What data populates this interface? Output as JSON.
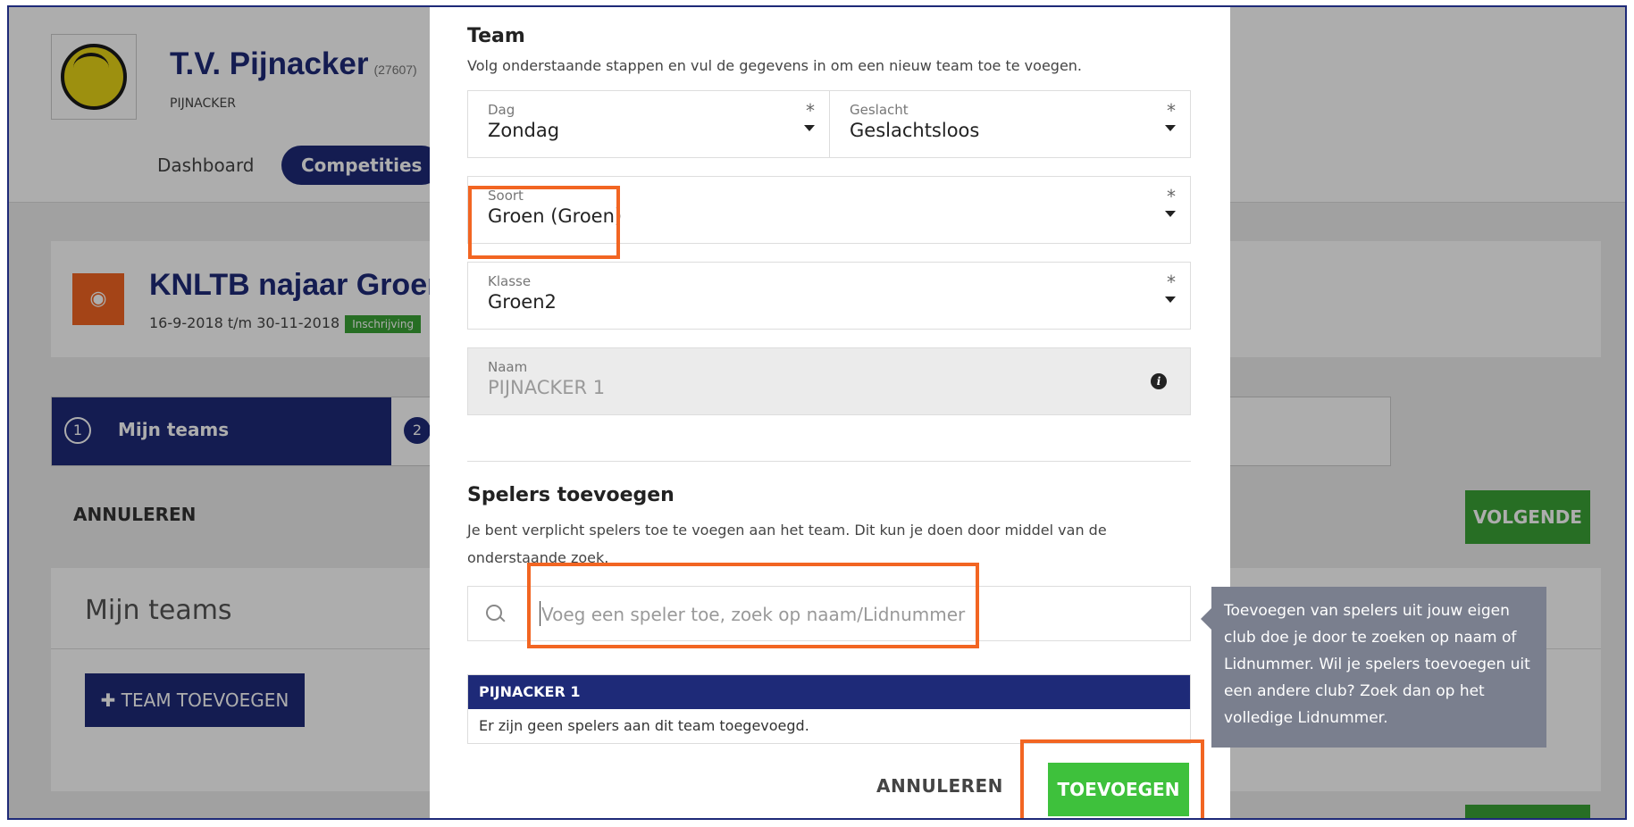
{
  "club": {
    "name": "T.V. Pijnacker",
    "code": "(27607)",
    "city": "PIJNACKER"
  },
  "nav": {
    "dashboard": "Dashboard",
    "competities": "Competities"
  },
  "competition": {
    "title": "KNLTB najaar Groen",
    "dates": "16-9-2018 t/m 30-11-2018",
    "badge": "Inschrijving"
  },
  "steps": [
    {
      "num": "1",
      "label": "Mijn teams"
    },
    {
      "num": "2"
    }
  ],
  "page_actions": {
    "cancel": "ANNULEREN",
    "next": "VOLGENDE"
  },
  "teams": {
    "title": "Mijn teams",
    "add_button": "TEAM TOEVOEGEN"
  },
  "modal": {
    "title": "Team",
    "description": "Volg onderstaande stappen en vul de gegevens in om een nieuw team toe te voegen.",
    "fields": {
      "dag": {
        "label": "Dag",
        "value": "Zondag",
        "required": "*"
      },
      "geslacht": {
        "label": "Geslacht",
        "value": "Geslachtsloos",
        "required": "*"
      },
      "soort": {
        "label": "Soort",
        "value": "Groen (Groen)",
        "required": "*"
      },
      "klasse": {
        "label": "Klasse",
        "value": "Groen2",
        "required": "*"
      },
      "naam": {
        "label": "Naam",
        "value": "PIJNACKER 1",
        "info_icon": "i"
      }
    },
    "players_title": "Spelers toevoegen",
    "players_description": "Je bent verplicht spelers toe te voegen aan het team. Dit kun je doen door middel van de onderstaande zoek.",
    "search": {
      "placeholder": "Voeg een speler toe, zoek op naam/Lidnummer"
    },
    "team_table": {
      "header": "PIJNACKER 1",
      "empty_text": "Er zijn geen spelers aan dit team toegevoegd."
    },
    "buttons": {
      "cancel": "ANNULEREN",
      "add": "TOEVOEGEN"
    }
  },
  "tooltip": {
    "text": "Toevoegen van spelers uit jouw eigen club doe je door te zoeken op naam of Lidnummer. Wil je spelers toevoegen uit een andere club? Zoek dan op het volledige Lidnummer."
  },
  "colors": {
    "brand": "#1e2a78",
    "green": "#3ec13c",
    "highlight": "#f26522",
    "tooltip": "#7a7f8e"
  }
}
